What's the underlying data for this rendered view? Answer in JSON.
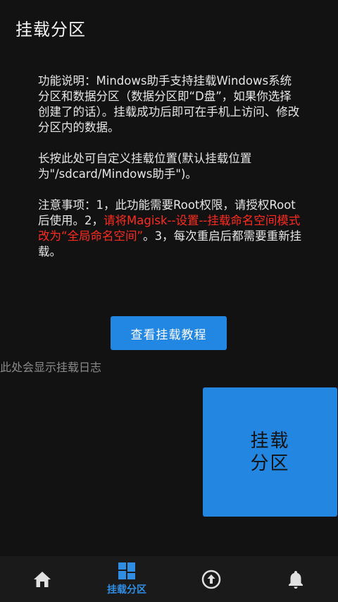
{
  "header": {
    "title": "挂载分区"
  },
  "description": {
    "p1": "功能说明：Mindows助手支持挂载Windows系统分区和数据分区（数据分区即“D盘”，如果你选择创建了的话）。挂载成功后即可在手机上访问、修改分区内的数据。",
    "p2": "长按此处可自定义挂载位置(默认挂载位置为\"/sdcard/Mindows助手\")。",
    "p3_a": "注意事项：1，此功能需要Root权限，请授权Root后使用。2，",
    "p3_red": "请将Magisk--设置--挂载命名空间模式 改为“全局命名空间”",
    "p3_b": "。3，每次重启后都需要重新挂载。"
  },
  "tutorial_button": {
    "label": "查看挂载教程"
  },
  "log": {
    "text": "此处会显示挂载日志"
  },
  "mount_button": {
    "line1": "挂载",
    "line2": "分区"
  },
  "bottom_nav": {
    "items": [
      {
        "icon": "home-icon",
        "label": ""
      },
      {
        "icon": "partition-icon",
        "label": "挂载分区",
        "active": true
      },
      {
        "icon": "upload-icon",
        "label": ""
      },
      {
        "icon": "bell-icon",
        "label": ""
      }
    ]
  },
  "colors": {
    "accent": "#2286e3",
    "warning": "#ff2b1f",
    "background": "#121212"
  }
}
